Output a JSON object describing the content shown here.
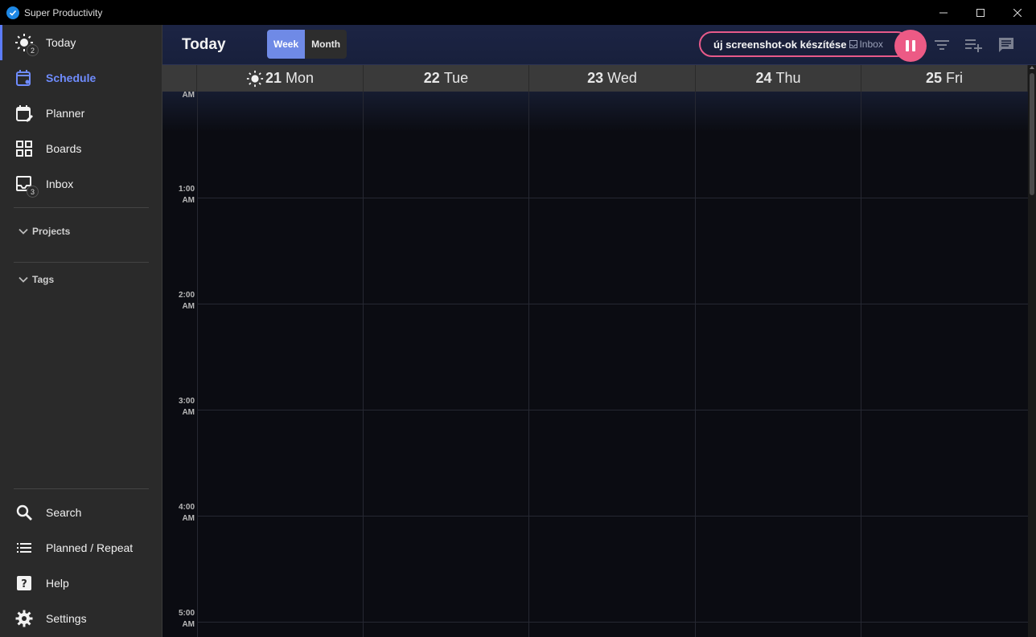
{
  "window": {
    "title": "Super Productivity"
  },
  "sidebar": {
    "items": [
      {
        "label": "Today",
        "badge": "2"
      },
      {
        "label": "Schedule"
      },
      {
        "label": "Planner"
      },
      {
        "label": "Boards"
      },
      {
        "label": "Inbox",
        "badge": "3"
      }
    ],
    "sections": [
      {
        "label": "Projects"
      },
      {
        "label": "Tags"
      }
    ],
    "bottom_items": [
      {
        "label": "Search"
      },
      {
        "label": "Planned / Repeat"
      },
      {
        "label": "Help"
      },
      {
        "label": "Settings"
      }
    ]
  },
  "header": {
    "title": "Today",
    "view_toggle": {
      "week": "Week",
      "month": "Month",
      "selected": "Week"
    },
    "current_task": {
      "title": "új screenshot-ok készítése",
      "project": "Inbox"
    }
  },
  "calendar": {
    "days": [
      {
        "num": "21",
        "name": "Mon",
        "is_today": true
      },
      {
        "num": "22",
        "name": "Tue"
      },
      {
        "num": "23",
        "name": "Wed"
      },
      {
        "num": "24",
        "name": "Thu"
      },
      {
        "num": "25",
        "name": "Fri"
      }
    ],
    "time_labels": [
      {
        "time": "",
        "ampm": "AM"
      },
      {
        "time": "1:00",
        "ampm": "AM"
      },
      {
        "time": "2:00",
        "ampm": "AM"
      },
      {
        "time": "3:00",
        "ampm": "AM"
      },
      {
        "time": "4:00",
        "ampm": "AM"
      },
      {
        "time": "5:00",
        "ampm": "AM"
      }
    ]
  },
  "colors": {
    "accent": "#6f8ae6",
    "pause": "#ec5a85",
    "sidebar_bg": "#2a2a2a",
    "calendar_bg": "#0b0c12"
  }
}
